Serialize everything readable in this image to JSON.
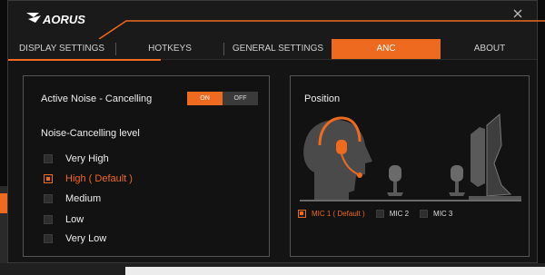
{
  "app": {
    "brand": "AORUS"
  },
  "colors": {
    "accent": "#ee6a1e",
    "panel_border": "#555555",
    "inactive_box": "#2e2e2e"
  },
  "tabs": [
    {
      "label": "DISPLAY SETTINGS",
      "active": false
    },
    {
      "label": "HOTKEYS",
      "active": false
    },
    {
      "label": "GENERAL SETTINGS",
      "active": false
    },
    {
      "label": "ANC",
      "active": true
    },
    {
      "label": "ABOUT",
      "active": false
    }
  ],
  "anc": {
    "label": "Active Noise - Cancelling",
    "toggle": {
      "on_label": "ON",
      "off_label": "OFF",
      "state": "ON"
    },
    "level_title": "Noise-Cancelling level",
    "levels": [
      {
        "label": "Very High",
        "selected": false
      },
      {
        "label": "High ( Default )",
        "selected": true
      },
      {
        "label": "Medium",
        "selected": false
      },
      {
        "label": "Low",
        "selected": false
      },
      {
        "label": "Very Low",
        "selected": false
      }
    ]
  },
  "position": {
    "title": "Position",
    "mics": [
      {
        "label": "MIC 1 ( Default )",
        "selected": true
      },
      {
        "label": "MIC 2",
        "selected": false
      },
      {
        "label": "MIC 3",
        "selected": false
      }
    ]
  },
  "icons": [
    "close-icon",
    "aorus-logo-icon",
    "head-with-headset-icon",
    "microphone-icon",
    "monitor-icon"
  ]
}
